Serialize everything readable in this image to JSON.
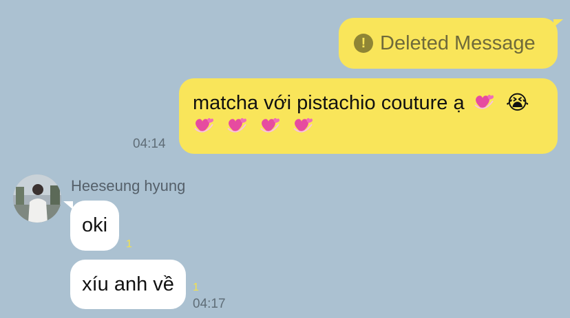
{
  "colors": {
    "background": "#abc1d1",
    "outgoing_bubble": "#f9e55a",
    "incoming_bubble": "#ffffff",
    "unread_count": "#f3e24a"
  },
  "outgoing": [
    {
      "type": "deleted",
      "icon": "warning-circle-icon",
      "icon_glyph": "!",
      "text": "Deleted Message"
    },
    {
      "type": "text",
      "line1": "matcha với pistachio couture ạ",
      "emojis_line1": [
        "revolving-hearts-emoji",
        "loudly-crying-face-emoji"
      ],
      "emojis_line2": [
        "revolving-hearts-emoji",
        "revolving-hearts-emoji",
        "revolving-hearts-emoji",
        "revolving-hearts-emoji"
      ],
      "crying_glyph": "😭",
      "time": "04:14"
    }
  ],
  "incoming_group": {
    "sender": "Heeseung hyung",
    "avatar": "user-avatar",
    "messages": [
      {
        "text": "oki",
        "unread": "1"
      },
      {
        "text": "xíu anh về",
        "unread": "1",
        "time": "04:17"
      }
    ]
  }
}
